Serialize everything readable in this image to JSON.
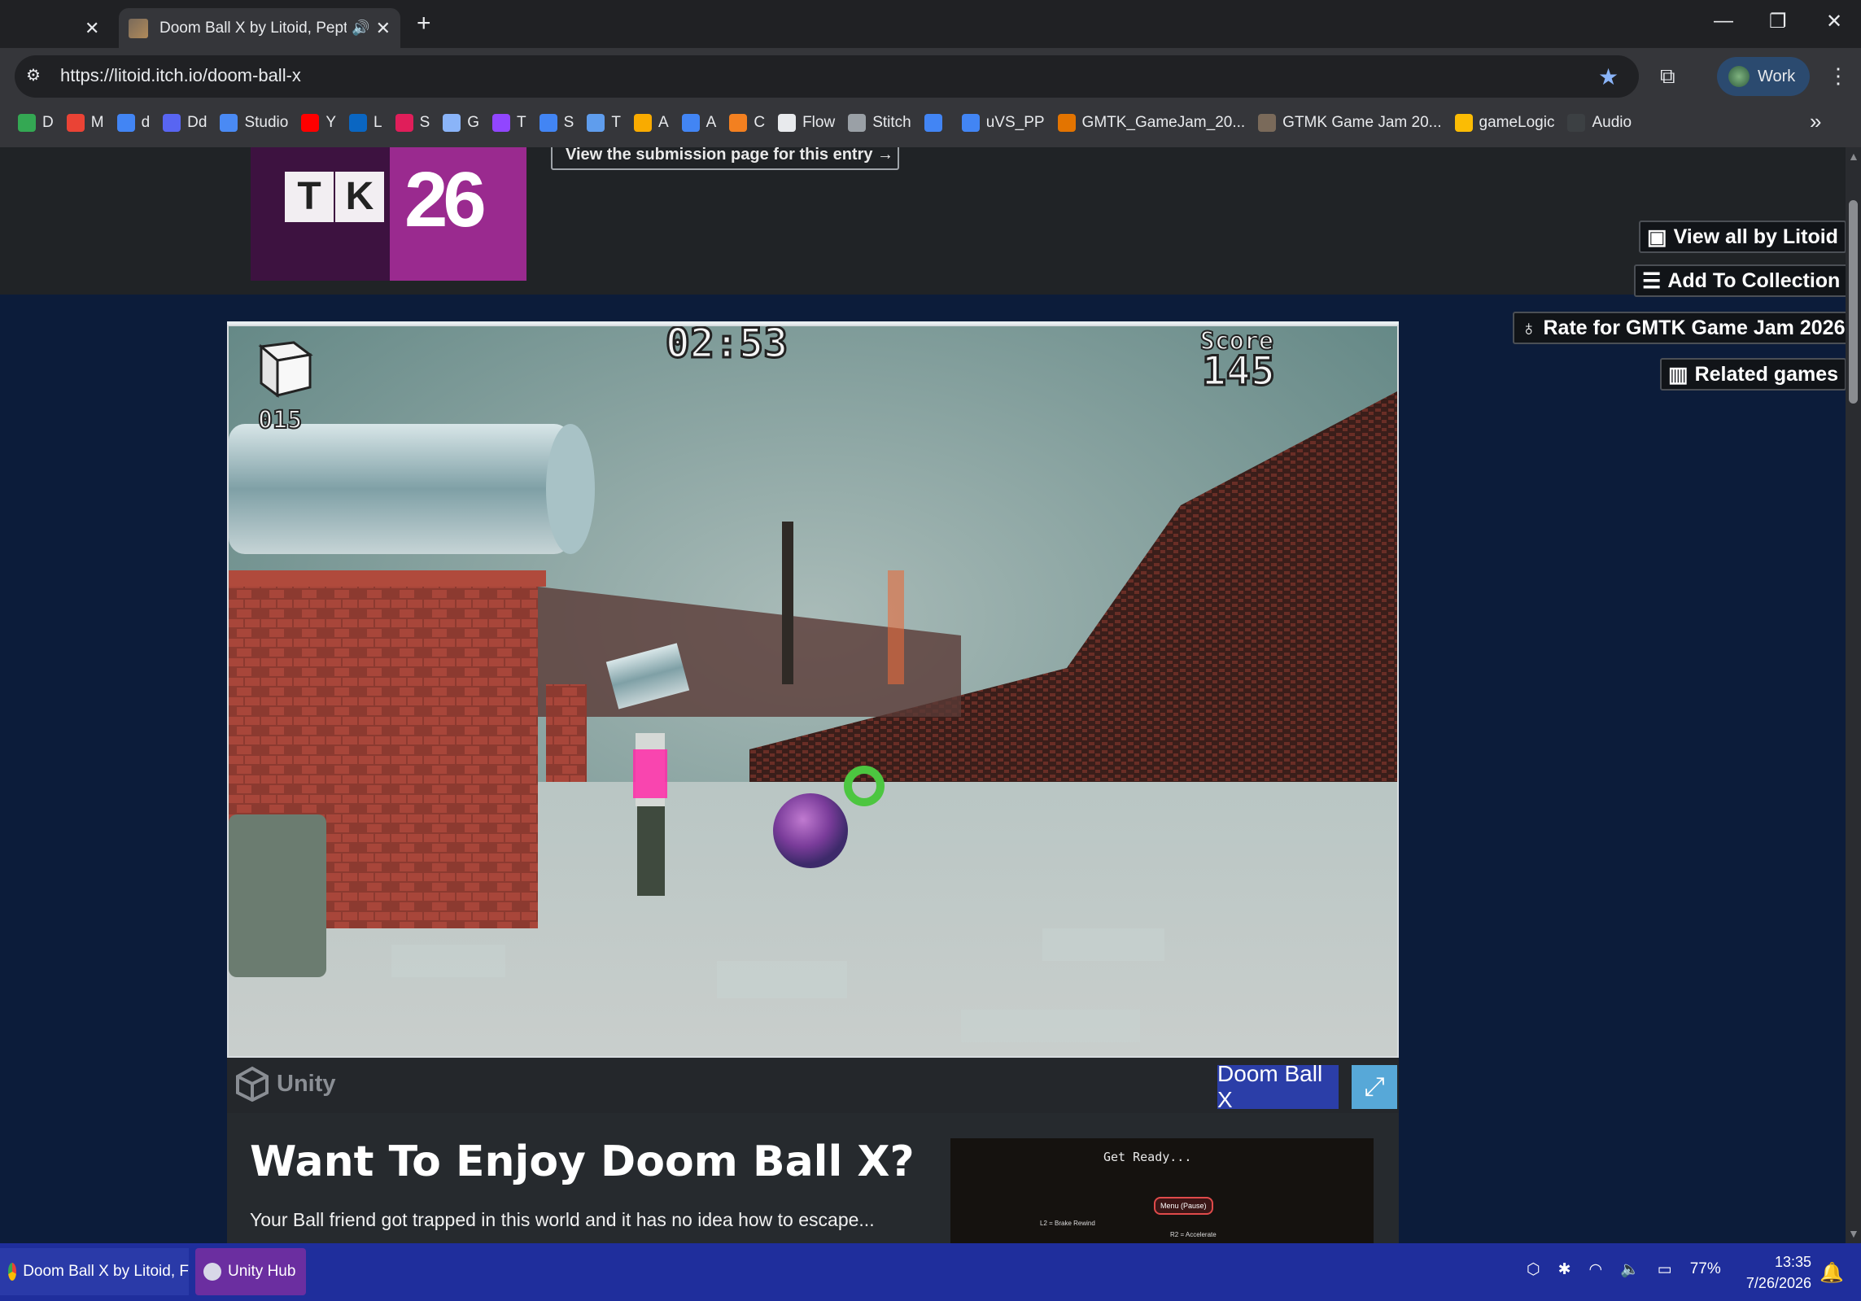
{
  "browser": {
    "tabs": [
      {
        "title": "",
        "active": false
      },
      {
        "title": "Doom Ball X by Litoid, Pepti",
        "active": true,
        "audio": true
      }
    ],
    "new_tab_symbol": "+",
    "window_controls": {
      "minimize": "—",
      "restore": "❐",
      "close": "✕"
    },
    "url": "https://litoid.itch.io/doom-ball-x",
    "profile_label": "Work",
    "bookmarks": [
      {
        "label": "D",
        "color": "#34a853"
      },
      {
        "label": "M",
        "color": "#ea4335"
      },
      {
        "label": "d",
        "color": "#4285f4"
      },
      {
        "label": "Dd",
        "color": "#5865f2"
      },
      {
        "label": "Studio",
        "color": "#4a8af4"
      },
      {
        "label": "Y",
        "color": "#ff0000"
      },
      {
        "label": "L",
        "color": "#0a66c2"
      },
      {
        "label": "S",
        "color": "#e01e5a"
      },
      {
        "label": "G",
        "color": "#8ab4f8"
      },
      {
        "label": "T",
        "color": "#9146ff"
      },
      {
        "label": "S",
        "color": "#4285f4"
      },
      {
        "label": "T",
        "color": "#5f9ded"
      },
      {
        "label": "A",
        "color": "#f9ab00"
      },
      {
        "label": "A",
        "color": "#4285f4"
      },
      {
        "label": "C",
        "color": "#f38020"
      },
      {
        "label": "Flow",
        "color": "#e8eaed"
      },
      {
        "label": "Stitch",
        "color": "#9aa0a6"
      },
      {
        "label": "",
        "color": "#4285f4"
      },
      {
        "label": "uVS_PP",
        "color": "#4285f4"
      },
      {
        "label": "GMTK_GameJam_20...",
        "color": "#e37400"
      },
      {
        "label": "GTMK Game Jam 20...",
        "color": "#7a6a5a"
      },
      {
        "label": "gameLogic",
        "color": "#fbbc04"
      },
      {
        "label": "Audio",
        "color": "#3c4043"
      }
    ]
  },
  "page": {
    "jam_logo": {
      "letters": [
        "T",
        "K"
      ],
      "year": "26"
    },
    "submission_link": "View the submission page for this entry →",
    "side_buttons": [
      {
        "label": "View all by Litoid",
        "icon": "itch-icon"
      },
      {
        "label": "Add To Collection",
        "icon": "add-list-icon"
      },
      {
        "label": "Rate for GMTK Game Jam 2026",
        "icon": "ribbon-icon"
      },
      {
        "label": "Related games",
        "icon": "map-icon"
      }
    ],
    "game": {
      "timer": "02:53",
      "score_label": "Score",
      "score": "145",
      "cube_count": "015",
      "engine_label": "Unity",
      "title_badge": "Doom Ball X",
      "fullscreen_icon": "⤢"
    },
    "heading": "Want To Enjoy Doom Ball X?",
    "description": "Your Ball friend got trapped in this world and it has no idea how to escape...",
    "screenshot_text": {
      "get_ready": "Get Ready...",
      "menu": "Menu (Pause)",
      "brake": "L2 = Brake Rewind",
      "accelerate": "R2 = Accelerate"
    }
  },
  "taskbar": {
    "apps": [
      {
        "label": "Doom Ball X by Litoid, F"
      },
      {
        "label": "Unity Hub"
      }
    ],
    "battery": "77%",
    "time": "13:35",
    "date": "7/26/2026"
  },
  "colors": {
    "page_bg": "#0c1c3a",
    "header_bg": "#202326",
    "taskbar": "#1f2e9c",
    "badge": "#2b3ea8",
    "fullscreen": "#57a8d8"
  }
}
